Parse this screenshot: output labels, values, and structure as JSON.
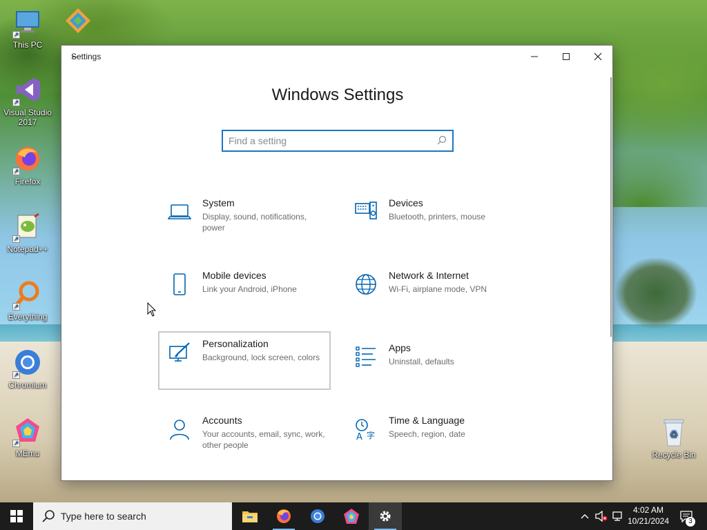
{
  "desktop": {
    "icons": [
      {
        "label": "This PC",
        "icon": "computer-icon"
      },
      {
        "label": "Visual Studio 2017",
        "icon": "visual-studio-icon"
      },
      {
        "label": "Firefox",
        "icon": "firefox-icon"
      },
      {
        "label": "Notepad++",
        "icon": "notepadpp-icon"
      },
      {
        "label": "Everything",
        "icon": "everything-search-icon"
      },
      {
        "label": "Chromium",
        "icon": "chromium-icon"
      },
      {
        "label": "MEmu",
        "icon": "memu-icon"
      }
    ],
    "recycle_bin": {
      "label": "Recycle Bin",
      "icon": "recycle-bin-icon"
    }
  },
  "window": {
    "title": "Settings",
    "heading": "Windows Settings",
    "search_placeholder": "Find a setting",
    "accent": "#0063b1",
    "tiles": [
      {
        "name": "System",
        "desc": "Display, sound, notifications, power",
        "icon": "laptop-icon"
      },
      {
        "name": "Devices",
        "desc": "Bluetooth, printers, mouse",
        "icon": "keyboard-speaker-icon"
      },
      {
        "name": "Mobile devices",
        "desc": "Link your Android, iPhone",
        "icon": "phone-icon"
      },
      {
        "name": "Network & Internet",
        "desc": "Wi-Fi, airplane mode, VPN",
        "icon": "globe-icon"
      },
      {
        "name": "Personalization",
        "desc": "Background, lock screen, colors",
        "icon": "paint-brush-icon"
      },
      {
        "name": "Apps",
        "desc": "Uninstall, defaults",
        "icon": "apps-list-icon"
      },
      {
        "name": "Accounts",
        "desc": "Your accounts, email, sync, work, other people",
        "icon": "person-icon"
      },
      {
        "name": "Time & Language",
        "desc": "Speech, region, date",
        "icon": "time-language-icon"
      }
    ]
  },
  "taskbar": {
    "search_label": "Type here to search",
    "apps": [
      {
        "name": "File Explorer",
        "icon": "folder-icon"
      },
      {
        "name": "Firefox",
        "icon": "firefox-icon"
      },
      {
        "name": "Chromium",
        "icon": "chromium-icon"
      },
      {
        "name": "MEmu",
        "icon": "memu-icon"
      },
      {
        "name": "Settings",
        "icon": "gear-icon"
      }
    ],
    "time": "4:02 AM",
    "date": "10/21/2024",
    "notification_count": "3"
  }
}
